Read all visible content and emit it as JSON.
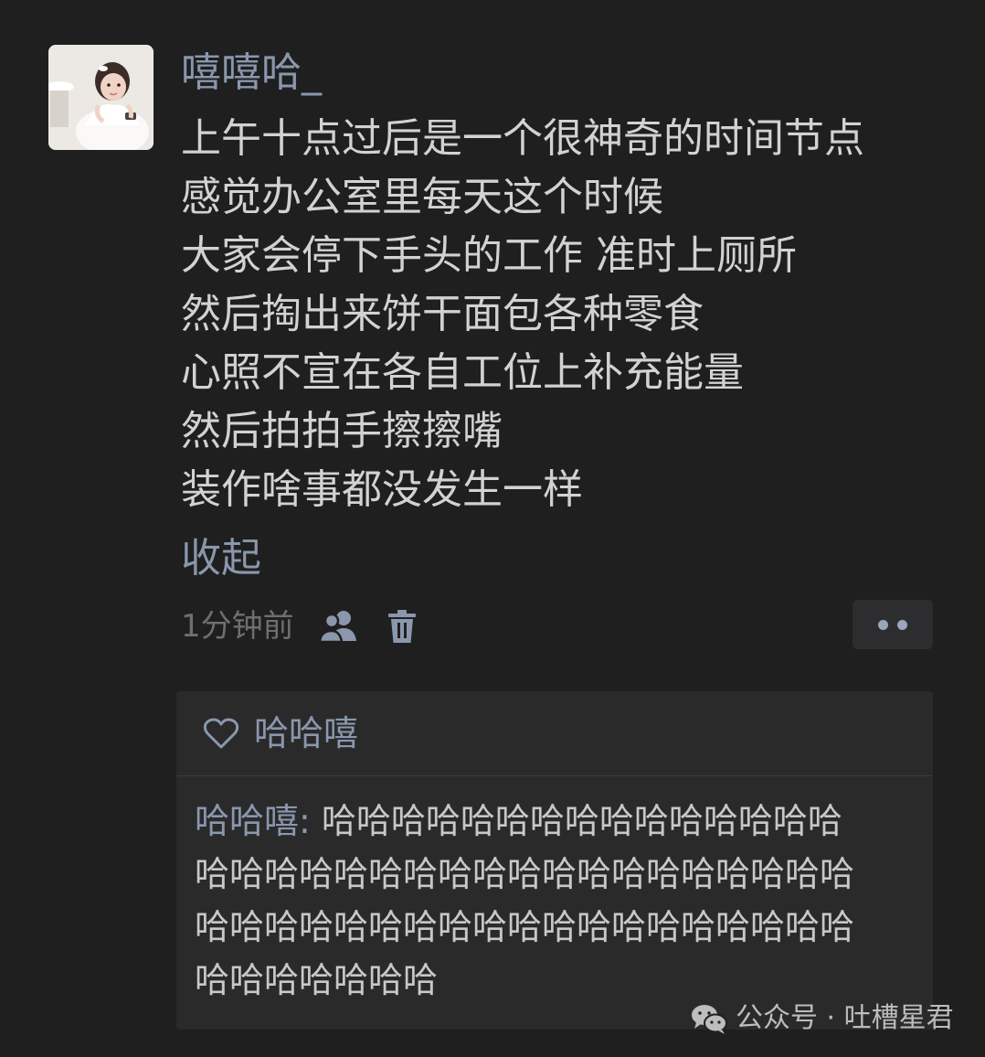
{
  "post": {
    "avatar_icon": "user-avatar-photo",
    "username": "嘻嘻哈_",
    "lines": [
      "上午十点过后是一个很神奇的时间节点",
      "感觉办公室里每天这个时候",
      "大家会停下手头的工作 准时上厕所",
      "然后掏出来饼干面包各种零食",
      "心照不宣在各自工位上补充能量",
      "然后拍拍手擦擦嘴",
      "装作啥事都没发生一样"
    ],
    "collapse_label": "收起",
    "timestamp": "1分钟前",
    "visibility_icon": "friends-icon",
    "delete_icon": "trash-icon",
    "more_icon": "more-dots-icon"
  },
  "interactions": {
    "like_icon": "heart-icon",
    "likers": "哈哈嘻",
    "comment": {
      "author": "哈哈嘻",
      "separator": ": ",
      "line1_rest": "哈哈哈哈哈哈哈哈哈哈哈哈哈哈哈",
      "line2": "哈哈哈哈哈哈哈哈哈哈哈哈哈哈哈哈哈哈哈",
      "line3": "哈哈哈哈哈哈哈哈哈哈哈哈哈哈哈哈哈哈哈",
      "line4": "哈哈哈哈哈哈哈"
    }
  },
  "watermark": {
    "icon": "wechat-icon",
    "text": "公众号 · 吐槽星君"
  },
  "colors": {
    "background": "#1f1f1f",
    "name_blue": "#8a97ad",
    "text": "#d2d2d2",
    "panel": "#2a2a2b"
  }
}
